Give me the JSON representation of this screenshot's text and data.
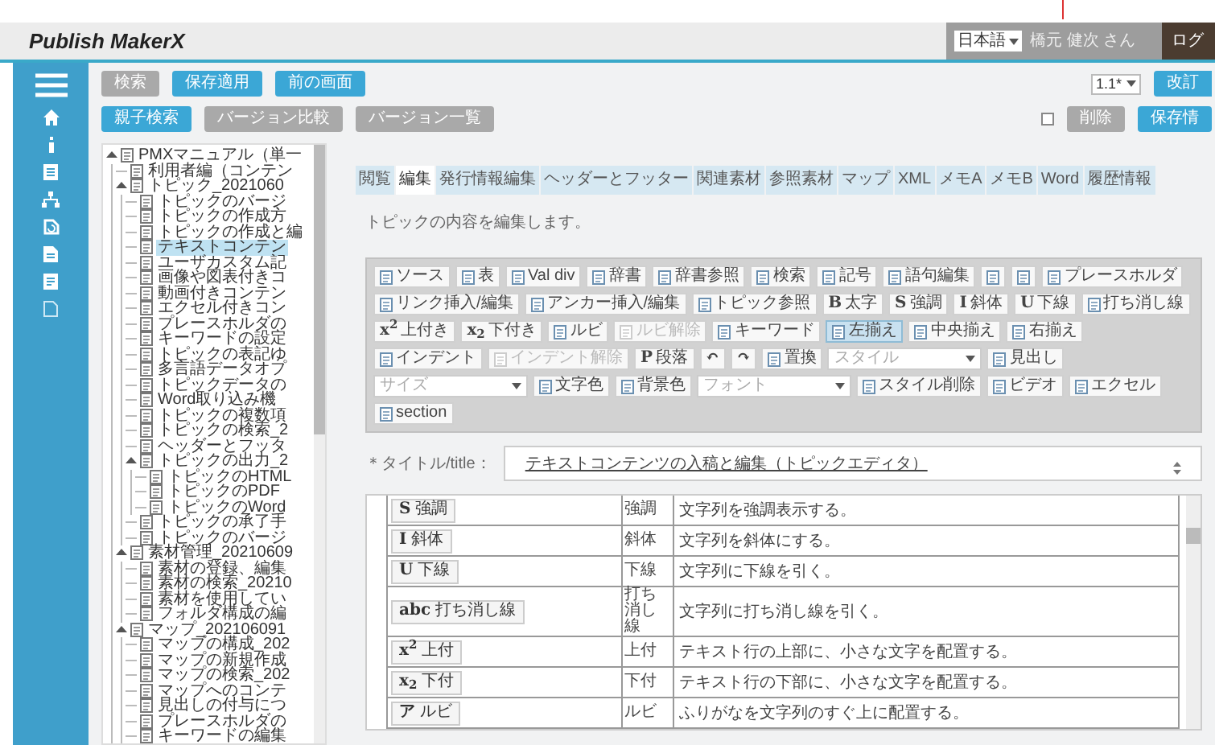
{
  "header": {
    "title": "Publish MakerX",
    "language": "日本語",
    "user": "橋元 健次 さん",
    "logout": "ログ"
  },
  "actions": {
    "row1": [
      {
        "label": "検索",
        "kind": "gray"
      },
      {
        "label": "保存適用",
        "kind": "blue"
      },
      {
        "label": "前の画面",
        "kind": "blue"
      }
    ],
    "row2": [
      {
        "label": "親子検索",
        "kind": "blue"
      },
      {
        "label": "バージョン比較",
        "kind": "gray"
      },
      {
        "label": "バージョン一覧",
        "kind": "gray"
      }
    ],
    "version": "1.1*",
    "right1": {
      "label": "改訂",
      "kind": "blue"
    },
    "checked": false,
    "right2": [
      {
        "label": "削除",
        "kind": "gray"
      },
      {
        "label": "保存情",
        "kind": "blue"
      }
    ]
  },
  "tree": {
    "items": [
      {
        "label": "PMXマニュアル（単一",
        "expanded": true,
        "selected": false,
        "children": [
          {
            "label": "利用者編（コンテン",
            "selected": false
          },
          {
            "label": "トピック_2021060",
            "expanded": true,
            "selected": false,
            "children": [
              {
                "label": "トピックのバージ",
                "selected": false
              },
              {
                "label": "トピックの作成方",
                "selected": false
              },
              {
                "label": "トピックの作成と編",
                "selected": false
              },
              {
                "label": "テキストコンテン",
                "selected": true
              },
              {
                "label": "ユーザカスタム記",
                "selected": false
              },
              {
                "label": "画像や図表付きコ",
                "selected": false
              },
              {
                "label": "動画付きコンテン",
                "selected": false
              },
              {
                "label": "エクセル付きコン",
                "selected": false
              },
              {
                "label": "プレースホルダの",
                "selected": false
              },
              {
                "label": "キーワードの設定",
                "selected": false
              },
              {
                "label": "トピックの表記ゆ",
                "selected": false
              },
              {
                "label": "多言語データオプ",
                "selected": false
              },
              {
                "label": "トピックデータの",
                "selected": false
              },
              {
                "label": "Word取り込み機",
                "selected": false
              },
              {
                "label": "トピックの複数項",
                "selected": false
              },
              {
                "label": "トピックの検索_2",
                "selected": false
              },
              {
                "label": "ヘッダーとフッタ",
                "selected": false
              },
              {
                "label": "トピックの出力_2",
                "expanded": true,
                "selected": false,
                "children": [
                  {
                    "label": "トピックのHTML",
                    "selected": false
                  },
                  {
                    "label": "トピックのPDF",
                    "selected": false
                  },
                  {
                    "label": "トピックのWord",
                    "selected": false
                  }
                ]
              },
              {
                "label": "トピックの承了手",
                "selected": false
              },
              {
                "label": "トピックのバージ",
                "selected": false
              }
            ]
          },
          {
            "label": "素材管理_20210609",
            "expanded": true,
            "selected": false,
            "children": [
              {
                "label": "素材の登録、編集",
                "selected": false
              },
              {
                "label": "素材の検索_20210",
                "selected": false
              },
              {
                "label": "素材を使用してい",
                "selected": false
              },
              {
                "label": "フォルダ構成の編",
                "selected": false
              }
            ]
          },
          {
            "label": "マップ_202106091",
            "expanded": true,
            "selected": false,
            "children": [
              {
                "label": "マップの構成_202",
                "selected": false
              },
              {
                "label": "マップの新規作成",
                "selected": false
              },
              {
                "label": "マップの検索_202",
                "selected": false
              },
              {
                "label": "マップへのコンテ",
                "selected": false
              },
              {
                "label": "見出しの付与につ",
                "selected": false
              },
              {
                "label": "プレースホルダの",
                "selected": false
              },
              {
                "label": "キーワードの編集",
                "selected": false
              }
            ]
          }
        ]
      }
    ]
  },
  "tabs": [
    {
      "label": "閲覧",
      "selected": false
    },
    {
      "label": "編集",
      "selected": true
    },
    {
      "label": "発行情報編集",
      "selected": false
    },
    {
      "label": "ヘッダーとフッター",
      "selected": false
    },
    {
      "label": "関連素材",
      "selected": false
    },
    {
      "label": "参照素材",
      "selected": false
    },
    {
      "label": "マップ",
      "selected": false
    },
    {
      "label": "XML",
      "selected": false
    },
    {
      "label": "メモA",
      "selected": false
    },
    {
      "label": "メモB",
      "selected": false
    },
    {
      "label": "Word",
      "selected": false
    },
    {
      "label": "履歴情報",
      "selected": false
    }
  ],
  "description": "トピックの内容を編集します。",
  "toolbar": [
    {
      "kind": "button",
      "label": "ソース",
      "selected": false,
      "disabled": false
    },
    {
      "kind": "button",
      "label": "表",
      "selected": false,
      "disabled": false
    },
    {
      "kind": "button",
      "label": "Val div",
      "selected": false,
      "disabled": false
    },
    {
      "kind": "button",
      "label": "辞書",
      "selected": false,
      "disabled": false
    },
    {
      "kind": "button",
      "label": "辞書参照",
      "selected": false,
      "disabled": false
    },
    {
      "kind": "button",
      "label": "検索",
      "selected": false,
      "disabled": false
    },
    {
      "kind": "button",
      "label": "記号",
      "selected": false,
      "disabled": false
    },
    {
      "kind": "button",
      "label": "語句編集",
      "selected": false,
      "disabled": false
    },
    {
      "kind": "button",
      "selected": false,
      "disabled": false
    },
    {
      "kind": "button",
      "selected": false,
      "disabled": false
    },
    {
      "kind": "button",
      "label": "プレースホルダ",
      "selected": false,
      "disabled": false
    },
    {
      "kind": "button",
      "label": "リンク挿入/編集",
      "selected": false,
      "disabled": false
    },
    {
      "kind": "button",
      "label": "アンカー挿入/編集",
      "selected": false,
      "disabled": false
    },
    {
      "kind": "button",
      "label": "トピック参照",
      "selected": false,
      "disabled": false
    },
    {
      "kind": "button",
      "glyph": "B",
      "label": "太字",
      "selected": false,
      "disabled": false
    },
    {
      "kind": "button",
      "glyph": "S",
      "label": "強調",
      "selected": false,
      "disabled": false
    },
    {
      "kind": "button",
      "glyph": "I",
      "label": "斜体",
      "selected": false,
      "disabled": false
    },
    {
      "kind": "button",
      "glyph": "U",
      "label": "下線",
      "selected": false,
      "disabled": false
    },
    {
      "kind": "button",
      "label": "打ち消し線",
      "selected": false,
      "disabled": false
    },
    {
      "kind": "button",
      "glyph": "x$^{2}$",
      "label": "上付き",
      "selected": false,
      "disabled": false
    },
    {
      "kind": "button",
      "glyph": "x$_{2}$",
      "label": "下付き",
      "selected": false,
      "disabled": false
    },
    {
      "kind": "button",
      "label": "ルビ",
      "selected": false,
      "disabled": false
    },
    {
      "kind": "button",
      "label": "ルビ解除",
      "selected": false,
      "disabled": true
    },
    {
      "kind": "button",
      "label": "キーワード",
      "selected": false,
      "disabled": false
    },
    {
      "kind": "button",
      "label": "左揃え",
      "selected": true,
      "disabled": false
    },
    {
      "kind": "button",
      "label": "中央揃え",
      "selected": false,
      "disabled": false
    },
    {
      "kind": "button",
      "label": "右揃え",
      "selected": false,
      "disabled": false
    },
    {
      "kind": "button",
      "label": "インデント",
      "selected": false,
      "disabled": false
    },
    {
      "kind": "button",
      "label": "インデント解除",
      "selected": false,
      "disabled": true
    },
    {
      "kind": "button",
      "glyph": "P",
      "label": "段落",
      "selected": false,
      "disabled": false
    },
    {
      "kind": "button",
      "glyph": "↶",
      "selected": false,
      "disabled": false
    },
    {
      "kind": "button",
      "glyph": "↷",
      "selected": false,
      "disabled": false
    },
    {
      "kind": "button",
      "label": "置換",
      "selected": false,
      "disabled": false
    },
    {
      "kind": "select",
      "label": "スタイル"
    },
    {
      "kind": "button",
      "label": "見出し",
      "selected": false,
      "disabled": false
    },
    {
      "kind": "select",
      "label": "サイズ"
    },
    {
      "kind": "button",
      "label": "文字色",
      "selected": false,
      "disabled": false
    },
    {
      "kind": "button",
      "label": "背景色",
      "selected": false,
      "disabled": false
    },
    {
      "kind": "select",
      "label": "フォント"
    },
    {
      "kind": "button",
      "label": "スタイル削除",
      "selected": false,
      "disabled": false
    },
    {
      "kind": "button",
      "label": "ビデオ",
      "selected": false,
      "disabled": false
    },
    {
      "kind": "button",
      "label": "エクセル",
      "selected": false,
      "disabled": false
    },
    {
      "kind": "button",
      "label": "section",
      "selected": false,
      "disabled": false
    }
  ],
  "title_field": {
    "label": "＊タイトル/title：",
    "value": "テキストコンテンツの入稿と編集（トピックエディタ）"
  },
  "table": {
    "rows": [
      {
        "glyph": "S",
        "button": "強調",
        "name": "強調",
        "description": "文字列を強調表示する。"
      },
      {
        "glyph": "I",
        "button": "斜体",
        "name": "斜体",
        "description": "文字列を斜体にする。"
      },
      {
        "glyph": "U",
        "button": "下線",
        "name": "下線",
        "description": "文字列に下線を引く。"
      },
      {
        "glyph": "abc",
        "button": "打ち消し線",
        "name": "打ち消し線",
        "description": "文字列に打ち消し線を引く。"
      },
      {
        "glyph": "x$^{2}$",
        "button": "上付",
        "name": "上付",
        "description": "テキスト行の上部に、小さな文字を配置する。"
      },
      {
        "glyph": "x$_{2}$",
        "button": "下付",
        "name": "下付",
        "description": "テキスト行の下部に、小さな文字を配置する。"
      },
      {
        "glyph": "ア",
        "button": "ルビ",
        "name": "ルビ",
        "description": "ふりがなを文字列のすぐ上に配置する。"
      }
    ]
  }
}
